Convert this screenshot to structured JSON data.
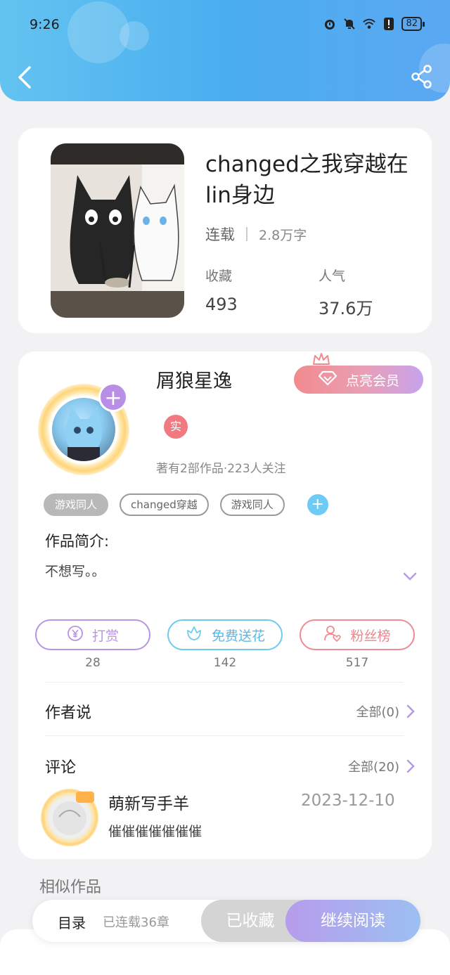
{
  "status_bar": {
    "time": "9:26",
    "battery": "82"
  },
  "book": {
    "title": "changed之我穿越在lin身边",
    "status": "连载",
    "word_count": "2.8万字",
    "favorites_label": "收藏",
    "favorites_value": "493",
    "popularity_label": "人气",
    "popularity_value": "37.6万"
  },
  "author": {
    "name": "屑狼星逸",
    "vip_label": "点亮会员",
    "real_badge": "实",
    "stats": "著有2部作品·223人关注"
  },
  "tags": [
    "游戏同人",
    "changed穿越",
    "游戏同人"
  ],
  "intro": {
    "label": "作品简介:",
    "text": "不想写。。"
  },
  "actions": [
    {
      "label": "打赏",
      "count": "28",
      "color": "#b894e4",
      "icon": "yen-icon"
    },
    {
      "label": "免费送花",
      "count": "142",
      "color": "#6ecbf0",
      "icon": "flower-icon"
    },
    {
      "label": "粉丝榜",
      "count": "517",
      "color": "#ee8c92",
      "icon": "fans-icon"
    }
  ],
  "author_says": {
    "title": "作者说",
    "link": "全部(0)"
  },
  "comments": {
    "title": "评论",
    "link": "全部(20)",
    "items": [
      {
        "user": "萌新写手羊",
        "date": "2023-12-10",
        "text": "催催催催催催催"
      }
    ]
  },
  "similar": {
    "title": "相似作品"
  },
  "bottom_bar": {
    "toc_label": "目录",
    "chapters": "已连载36章",
    "collected_label": "已收藏",
    "read_label": "继续阅读"
  },
  "colors": {
    "header": "#4aaef0",
    "accent_purple": "#b98ee6",
    "vip_pink": "#f28a8e"
  }
}
